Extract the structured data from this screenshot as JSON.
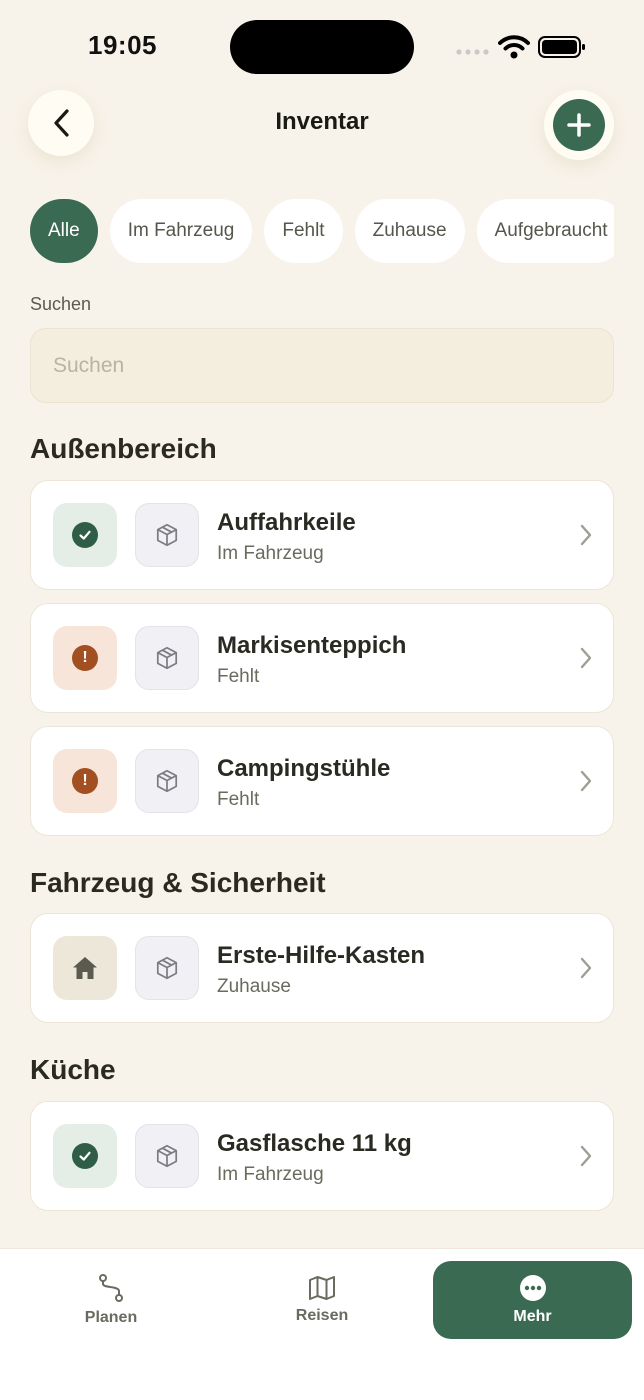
{
  "status_bar": {
    "time": "19:05"
  },
  "header": {
    "title": "Inventar",
    "back_icon": "chevron-left-icon",
    "add_icon": "plus-icon"
  },
  "filters": [
    {
      "label": "Alle",
      "active": true
    },
    {
      "label": "Im Fahrzeug",
      "active": false
    },
    {
      "label": "Fehlt",
      "active": false
    },
    {
      "label": "Zuhause",
      "active": false
    },
    {
      "label": "Aufgebraucht",
      "active": false
    }
  ],
  "search": {
    "label": "Suchen",
    "placeholder": "Suchen",
    "value": ""
  },
  "sections": [
    {
      "title": "Außenbereich",
      "items": [
        {
          "name": "Auffahrkeile",
          "status": "Im Fahrzeug",
          "status_type": "ok"
        },
        {
          "name": "Markisenteppich",
          "status": "Fehlt",
          "status_type": "missing"
        },
        {
          "name": "Campingstühle",
          "status": "Fehlt",
          "status_type": "missing"
        }
      ]
    },
    {
      "title": "Fahrzeug & Sicherheit",
      "items": [
        {
          "name": "Erste-Hilfe-Kasten",
          "status": "Zuhause",
          "status_type": "home"
        }
      ]
    },
    {
      "title": "Küche",
      "items": [
        {
          "name": "Gasflasche 11 kg",
          "status": "Im Fahrzeug",
          "status_type": "ok"
        }
      ]
    }
  ],
  "tabbar": [
    {
      "label": "Planen",
      "icon": "route-icon",
      "active": false
    },
    {
      "label": "Reisen",
      "icon": "map-icon",
      "active": false
    },
    {
      "label": "Mehr",
      "icon": "more-icon",
      "active": true
    }
  ],
  "colors": {
    "accent": "#3a6a52",
    "background": "#f8f3ea",
    "ok": "#2f5d46",
    "missing": "#a24f22"
  }
}
